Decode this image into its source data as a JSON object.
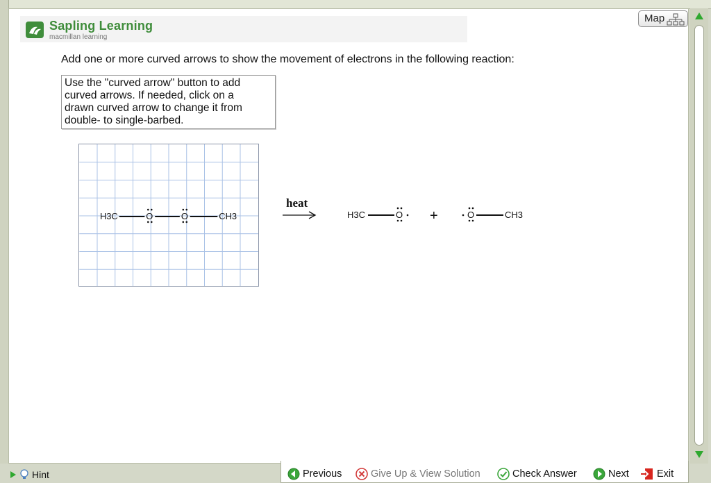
{
  "app": {
    "brand": "Sapling Learning",
    "brand_sub": "macmillan learning",
    "brand_color": "#3f8d3b"
  },
  "map_button": {
    "label": "Map",
    "icon": "sitemap-icon"
  },
  "question": {
    "prompt": "Add one or more curved arrows to show the movement of electrons in the following reaction:"
  },
  "instructions": {
    "lines": [
      "Use the \"curved arrow\" button to add",
      "curved arrows. If needed, click on a",
      "drawn curved arrow to change it from",
      "double- to single-barbed."
    ]
  },
  "reaction": {
    "reactant": {
      "left_group": "H3C",
      "atom1": "O",
      "atom2": "O",
      "right_group": "CH3"
    },
    "condition": "heat",
    "plus": "+",
    "product1": {
      "group": "H3C",
      "atom": "O"
    },
    "product2": {
      "atom": "O",
      "group": "CH3"
    }
  },
  "footer": {
    "hint": "Hint",
    "previous": "Previous",
    "give_up": "Give Up & View Solution",
    "check_answer": "Check Answer",
    "next": "Next",
    "exit": "Exit"
  },
  "colors": {
    "grid_line": "#a9c1e6",
    "scroll_arrow": "#2fa82f",
    "ok_green": "#3aa63a",
    "giveup_red": "#d23a3a",
    "exit_red": "#d8261f"
  }
}
